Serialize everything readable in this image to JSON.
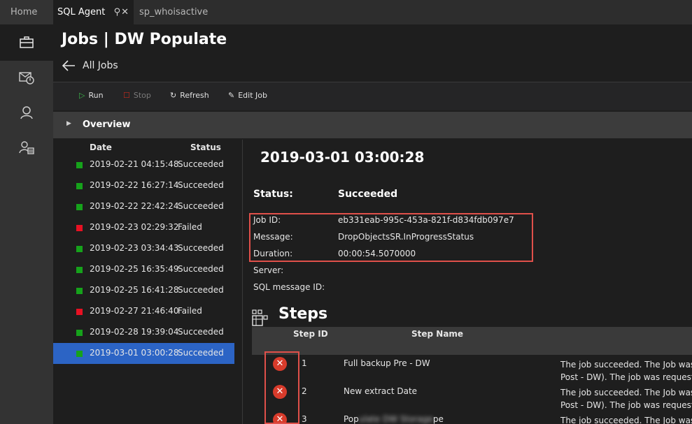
{
  "tabs": [
    {
      "label": "Home"
    },
    {
      "label": "SQL Agent",
      "icons": "⚲✕"
    },
    {
      "label": "sp_whoisactive"
    }
  ],
  "activity_icons": [
    "briefcase-icon",
    "mail-alert-icon",
    "person-icon",
    "people-admin-icon"
  ],
  "header": {
    "title": "Jobs | DW Populate",
    "back_label": "All Jobs"
  },
  "toolbar": {
    "run": "Run",
    "stop": "Stop",
    "refresh": "Refresh",
    "edit": "Edit Job"
  },
  "overview": {
    "label": "Overview"
  },
  "history": {
    "col_date": "Date",
    "col_status": "Status",
    "rows": [
      {
        "date": "2019-02-21 04:15:48",
        "status": "Succeeded",
        "color": "#16a21b"
      },
      {
        "date": "2019-02-22 16:27:14",
        "status": "Succeeded",
        "color": "#16a21b"
      },
      {
        "date": "2019-02-22 22:42:24",
        "status": "Succeeded",
        "color": "#16a21b"
      },
      {
        "date": "2019-02-23 02:29:32",
        "status": "Failed",
        "color": "#e81123"
      },
      {
        "date": "2019-02-23 03:34:43",
        "status": "Succeeded",
        "color": "#16a21b"
      },
      {
        "date": "2019-02-25 16:35:49",
        "status": "Succeeded",
        "color": "#16a21b"
      },
      {
        "date": "2019-02-25 16:41:28",
        "status": "Succeeded",
        "color": "#16a21b"
      },
      {
        "date": "2019-02-27 21:46:40",
        "status": "Failed",
        "color": "#e81123"
      },
      {
        "date": "2019-02-28 19:39:04",
        "status": "Succeeded",
        "color": "#16a21b"
      },
      {
        "date": "2019-03-01 03:00:28",
        "status": "Succeeded",
        "color": "#16a21b",
        "selected": true
      }
    ]
  },
  "detail": {
    "title": "2019-03-01 03:00:28",
    "status_label": "Status:",
    "status_value": "Succeeded",
    "job_id_label": "Job ID:",
    "job_id_value": "eb331eab-995c-453a-821f-d834fdb097e7",
    "message_label": "Message:",
    "message_value": "DropObjectsSR.InProgressStatus",
    "duration_label": "Duration:",
    "duration_value": "00:00:54.5070000",
    "server_label": "Server:",
    "sqlmsg_label": "SQL message ID:"
  },
  "steps": {
    "title": "Steps",
    "col_id": "Step ID",
    "col_name": "Step Name",
    "rows": [
      {
        "id": "1",
        "name": "Full backup Pre - DW",
        "msg1": "The job succeeded. The Job was",
        "msg2": "Post - DW). The job was request"
      },
      {
        "id": "2",
        "name": "New extract Date",
        "msg1": "The job succeeded. The Job was",
        "msg2": "Post - DW). The job was request"
      },
      {
        "id": "3",
        "name": "Pop",
        "name_blurred": "ulate DW Storage",
        "name_tail": "pe",
        "msg1": "The job succeeded. The Job was",
        "msg2": ""
      }
    ]
  }
}
